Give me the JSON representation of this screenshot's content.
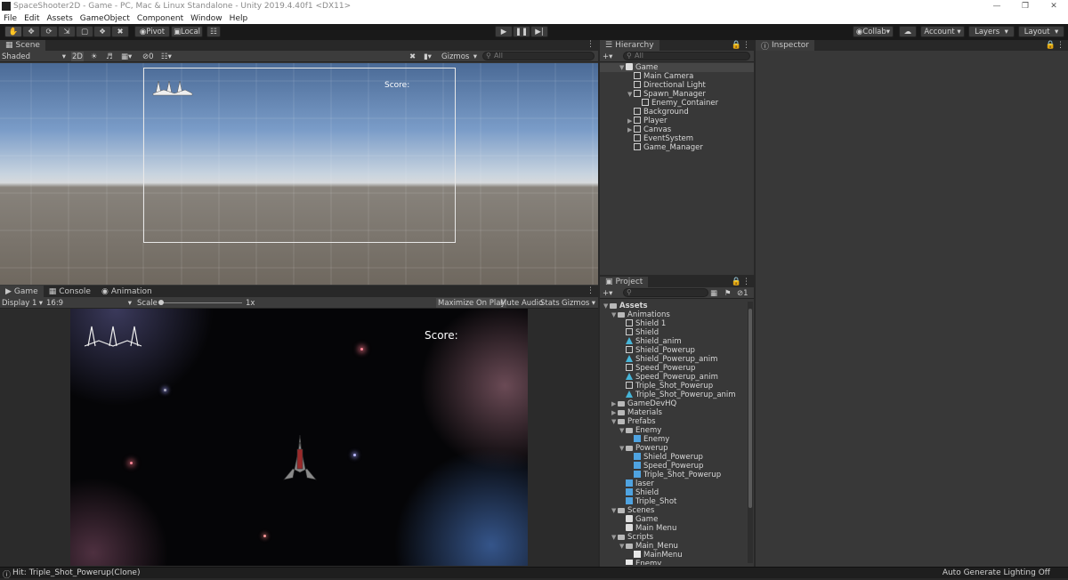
{
  "window": {
    "title": "SpaceShooter2D - Game - PC, Mac & Linux Standalone - Unity 2019.4.40f1 <DX11>"
  },
  "menu": [
    "File",
    "Edit",
    "Assets",
    "GameObject",
    "Component",
    "Window",
    "Help"
  ],
  "toolbar": {
    "pivot_label": "Pivot",
    "local_label": "Local",
    "collab_label": "Collab",
    "account_label": "Account",
    "layers_label": "Layers",
    "layout_label": "Layout"
  },
  "scene_panel": {
    "tab_label": "Scene",
    "shading_mode": "Shaded",
    "mode_2d": "2D",
    "hidden_count": "0",
    "gizmos_label": "Gizmos",
    "search_placeholder": "All",
    "score_label": "Score:"
  },
  "game_panel": {
    "tabs": [
      "Game",
      "Console",
      "Animation"
    ],
    "display_label": "Display 1",
    "aspect_label": "16:9",
    "scale_label": "Scale",
    "scale_value": "1x",
    "maximize_label": "Maximize On Play",
    "mute_label": "Mute Audio",
    "stats_label": "Stats",
    "gizmos_label": "Gizmos",
    "score_label": "Score:"
  },
  "hierarchy": {
    "tab_label": "Hierarchy",
    "search_placeholder": "All",
    "items": [
      {
        "label": "Game",
        "depth": 0,
        "arrow": "down",
        "icon": "unity"
      },
      {
        "label": "Main Camera",
        "depth": 1,
        "arrow": "",
        "icon": "cube"
      },
      {
        "label": "Directional Light",
        "depth": 1,
        "arrow": "",
        "icon": "cube"
      },
      {
        "label": "Spawn_Manager",
        "depth": 1,
        "arrow": "down",
        "icon": "cube"
      },
      {
        "label": "Enemy_Container",
        "depth": 2,
        "arrow": "",
        "icon": "cube"
      },
      {
        "label": "Background",
        "depth": 1,
        "arrow": "",
        "icon": "cube"
      },
      {
        "label": "Player",
        "depth": 1,
        "arrow": "right",
        "icon": "cube"
      },
      {
        "label": "Canvas",
        "depth": 1,
        "arrow": "right",
        "icon": "cube"
      },
      {
        "label": "EventSystem",
        "depth": 1,
        "arrow": "",
        "icon": "cube"
      },
      {
        "label": "Game_Manager",
        "depth": 1,
        "arrow": "",
        "icon": "cube"
      }
    ]
  },
  "inspector": {
    "tab_label": "Inspector"
  },
  "project": {
    "tab_label": "Project",
    "hidden_count": "1",
    "items": [
      {
        "label": "Assets",
        "depth": 0,
        "arrow": "down",
        "icon": "folder",
        "bold": true
      },
      {
        "label": "Animations",
        "depth": 1,
        "arrow": "down",
        "icon": "folder"
      },
      {
        "label": "Shield 1",
        "depth": 2,
        "arrow": "",
        "icon": "cube"
      },
      {
        "label": "Shield",
        "depth": 2,
        "arrow": "",
        "icon": "cube"
      },
      {
        "label": "Shield_anim",
        "depth": 2,
        "arrow": "",
        "icon": "anim"
      },
      {
        "label": "Shield_Powerup",
        "depth": 2,
        "arrow": "",
        "icon": "cube"
      },
      {
        "label": "Shield_Powerup_anim",
        "depth": 2,
        "arrow": "",
        "icon": "anim"
      },
      {
        "label": "Speed_Powerup",
        "depth": 2,
        "arrow": "",
        "icon": "cube"
      },
      {
        "label": "Speed_Powerup_anim",
        "depth": 2,
        "arrow": "",
        "icon": "anim"
      },
      {
        "label": "Triple_Shot_Powerup",
        "depth": 2,
        "arrow": "",
        "icon": "cube"
      },
      {
        "label": "Triple_Shot_Powerup_anim",
        "depth": 2,
        "arrow": "",
        "icon": "anim"
      },
      {
        "label": "GameDevHQ",
        "depth": 1,
        "arrow": "right",
        "icon": "folder"
      },
      {
        "label": "Materials",
        "depth": 1,
        "arrow": "right",
        "icon": "folder"
      },
      {
        "label": "Prefabs",
        "depth": 1,
        "arrow": "down",
        "icon": "folder"
      },
      {
        "label": "Enemy",
        "depth": 2,
        "arrow": "down",
        "icon": "folder"
      },
      {
        "label": "Enemy",
        "depth": 3,
        "arrow": "",
        "icon": "prefab"
      },
      {
        "label": "Powerup",
        "depth": 2,
        "arrow": "down",
        "icon": "folder"
      },
      {
        "label": "Shield_Powerup",
        "depth": 3,
        "arrow": "",
        "icon": "prefab"
      },
      {
        "label": "Speed_Powerup",
        "depth": 3,
        "arrow": "",
        "icon": "prefab"
      },
      {
        "label": "Triple_Shot_Powerup",
        "depth": 3,
        "arrow": "",
        "icon": "prefab"
      },
      {
        "label": "laser",
        "depth": 2,
        "arrow": "",
        "icon": "prefab"
      },
      {
        "label": "Shield",
        "depth": 2,
        "arrow": "",
        "icon": "prefab"
      },
      {
        "label": "Triple_Shot",
        "depth": 2,
        "arrow": "",
        "icon": "prefab"
      },
      {
        "label": "Scenes",
        "depth": 1,
        "arrow": "down",
        "icon": "folder"
      },
      {
        "label": "Game",
        "depth": 2,
        "arrow": "",
        "icon": "unity"
      },
      {
        "label": "Main Menu",
        "depth": 2,
        "arrow": "",
        "icon": "unity"
      },
      {
        "label": "Scripts",
        "depth": 1,
        "arrow": "down",
        "icon": "folder"
      },
      {
        "label": "Main_Menu",
        "depth": 2,
        "arrow": "down",
        "icon": "folder"
      },
      {
        "label": "MainMenu",
        "depth": 3,
        "arrow": "",
        "icon": "script"
      },
      {
        "label": "Enemy",
        "depth": 2,
        "arrow": "",
        "icon": "script"
      }
    ]
  },
  "status": {
    "message": "Hit: Triple_Shot_Powerup(Clone)",
    "right_label": "Auto Generate Lighting Off"
  }
}
